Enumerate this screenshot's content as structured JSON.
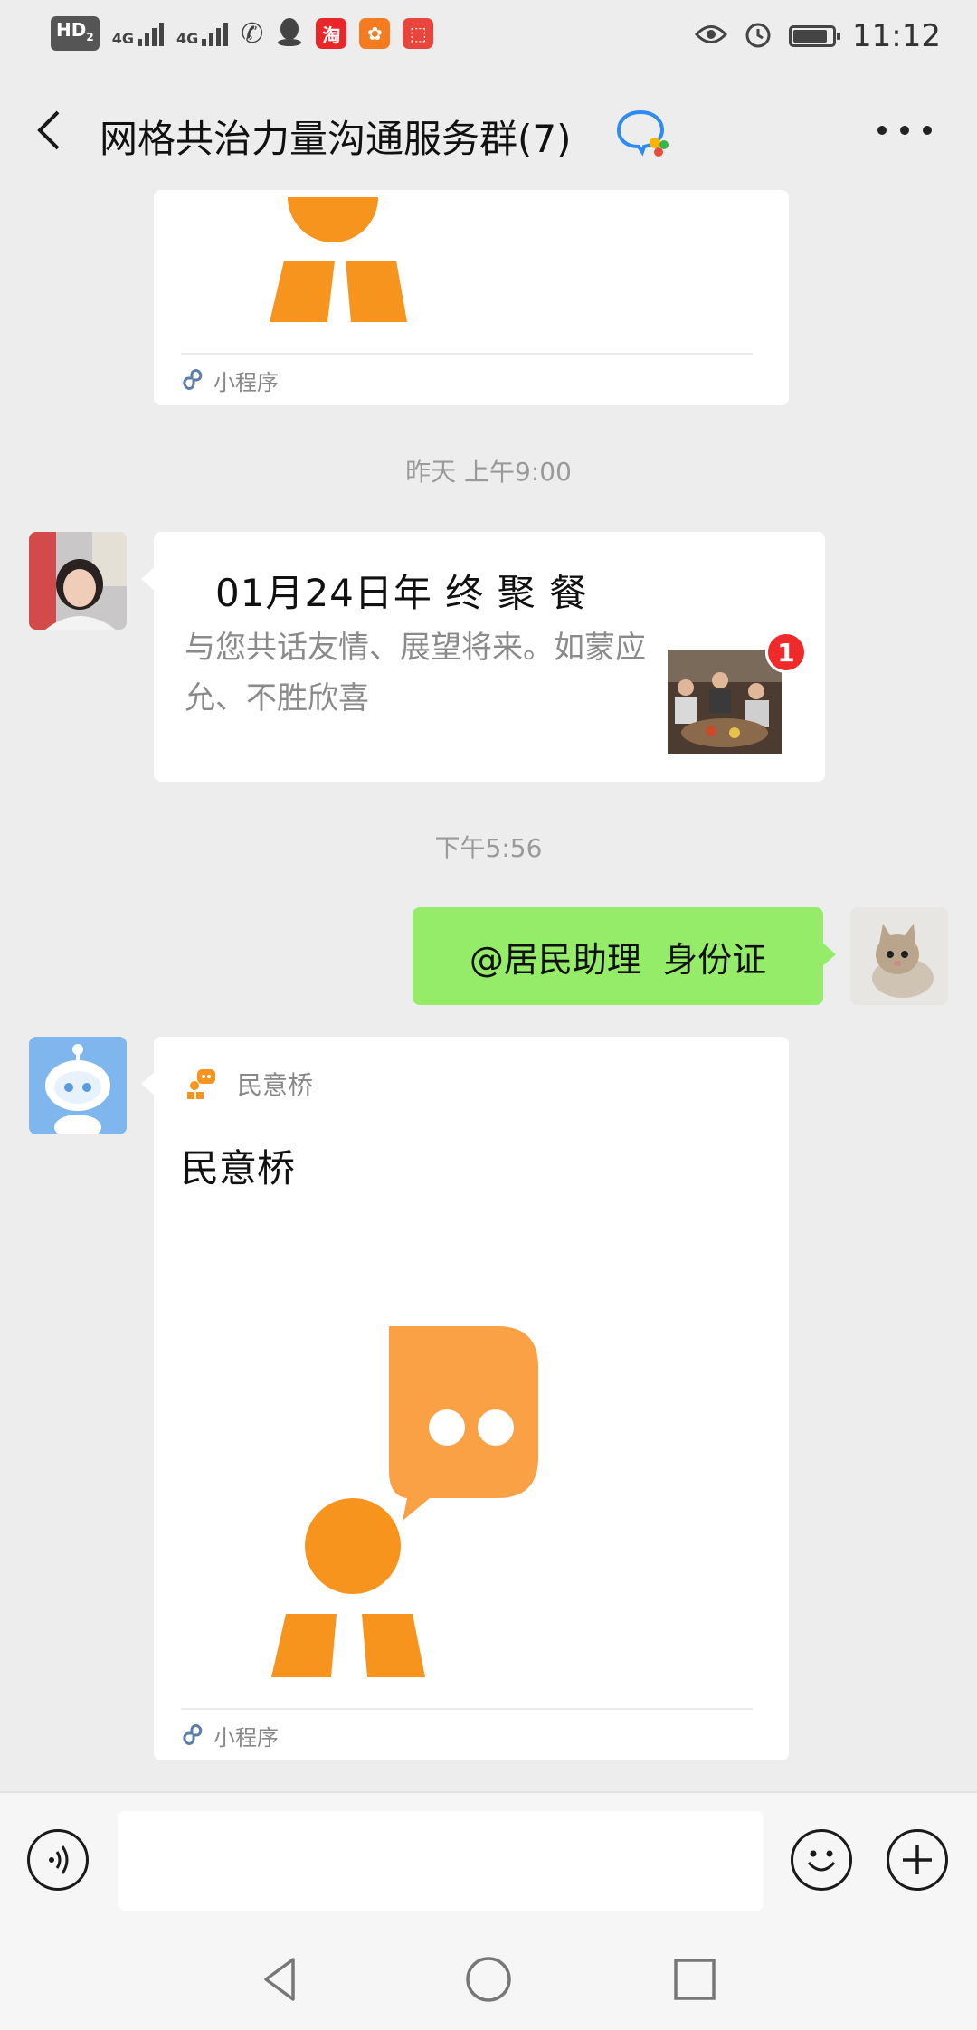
{
  "status_bar": {
    "hd": "HD",
    "hd_sub": "2",
    "net1": "4G",
    "net2": "4G",
    "app_icons": [
      {
        "name": "taobao-icon",
        "glyph": "淘",
        "color": "#e8272a"
      },
      {
        "name": "uc-browser-icon",
        "glyph": "✿",
        "color": "#f47b1f"
      },
      {
        "name": "video-app-icon",
        "glyph": "⬚",
        "color": "#e8463c"
      }
    ],
    "time": "11:12"
  },
  "header": {
    "title": "网格共治力量沟通服务群(7)"
  },
  "messages": {
    "top_card_footer": "小程序",
    "time_1": "昨天 上午9:00",
    "invite": {
      "title": "01月24日年 终 聚 餐",
      "desc": "与您共话友情、展望将来。如蒙应允、不胜欣喜",
      "badge": "1"
    },
    "time_2": "下午5:56",
    "my_message": "@居民助理  身份证",
    "mini_program": {
      "app_name": "民意桥",
      "title": "民意桥",
      "footer": "小程序"
    }
  },
  "input_bar": {
    "placeholder": ""
  },
  "colors": {
    "accent_orange": "#f7941d",
    "my_bubble": "#95ec69",
    "chat_bg": "#ededed"
  }
}
